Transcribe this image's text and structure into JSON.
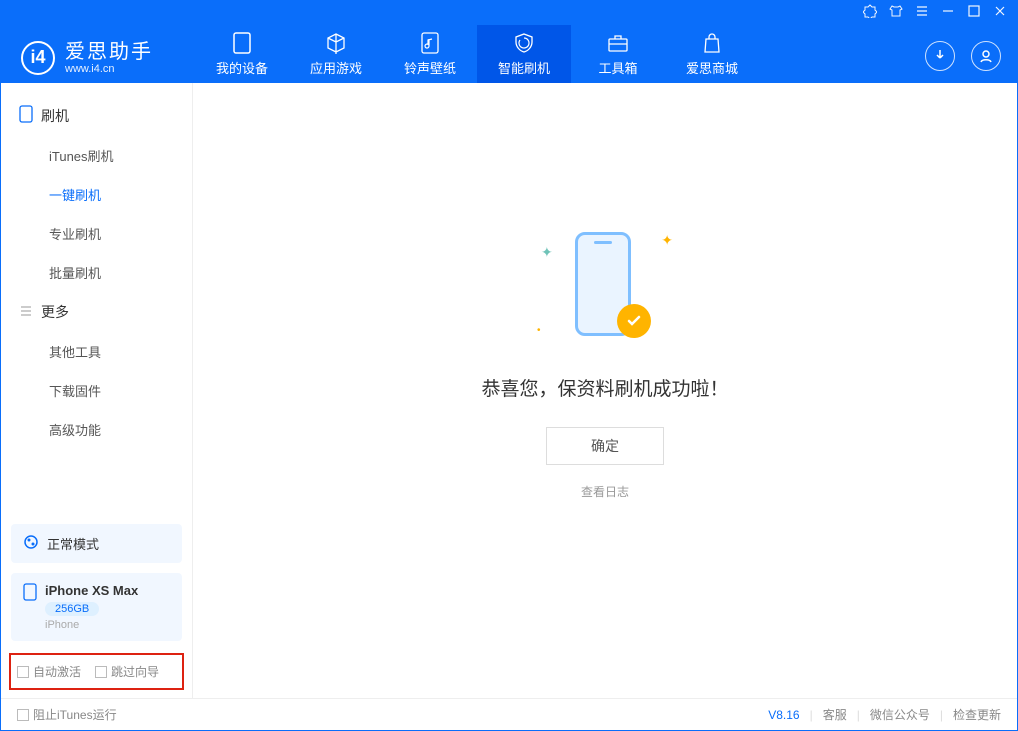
{
  "brand": {
    "name": "爱思助手",
    "url": "www.i4.cn"
  },
  "tabs": [
    {
      "label": "我的设备"
    },
    {
      "label": "应用游戏"
    },
    {
      "label": "铃声壁纸"
    },
    {
      "label": "智能刷机"
    },
    {
      "label": "工具箱"
    },
    {
      "label": "爱思商城"
    }
  ],
  "sidebar": {
    "group1": {
      "title": "刷机",
      "items": [
        "iTunes刷机",
        "一键刷机",
        "专业刷机",
        "批量刷机"
      ]
    },
    "group2": {
      "title": "更多",
      "items": [
        "其他工具",
        "下载固件",
        "高级功能"
      ]
    }
  },
  "device_mode": {
    "label": "正常模式"
  },
  "device": {
    "name": "iPhone XS Max",
    "capacity": "256GB",
    "type": "iPhone"
  },
  "options": {
    "auto_activate": "自动激活",
    "skip_guide": "跳过向导"
  },
  "main": {
    "success_text": "恭喜您，保资料刷机成功啦！",
    "ok_button": "确定",
    "view_log": "查看日志"
  },
  "footer": {
    "block_itunes": "阻止iTunes运行",
    "version": "V8.16",
    "customer_service": "客服",
    "wechat": "微信公众号",
    "check_update": "检查更新"
  }
}
